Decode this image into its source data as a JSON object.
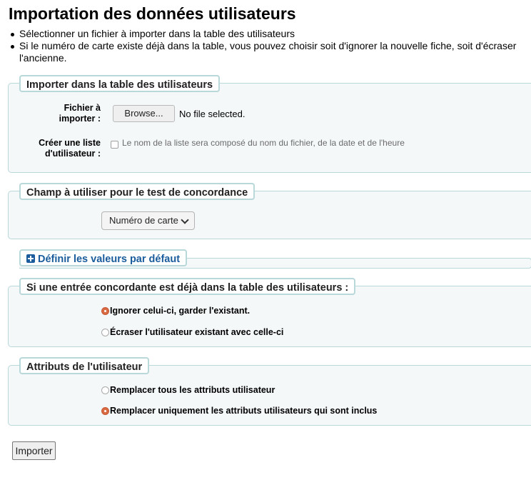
{
  "page": {
    "title": "Importation des données utilisateurs",
    "intro": [
      "Sélectionner un fichier à importer dans la table des utilisateurs",
      "Si le numéro de carte existe déjà dans la table, vous pouvez choisir soit d'ignorer la nouvelle fiche, soit d'écraser l'ancienne."
    ]
  },
  "import_section": {
    "legend": "Importer dans la table des utilisateurs",
    "file_label": [
      "Fichier à",
      "importer :"
    ],
    "browse_label": "Browse...",
    "no_file": "No file selected.",
    "list_label": [
      "Créer une liste",
      "d'utilisateur :"
    ],
    "list_hint": "Le nom de la liste sera composé du nom du fichier, de la date et de l'heure",
    "list_checked": false
  },
  "match_section": {
    "legend": "Champ à utiliser pour le test de concordance",
    "selected": "Numéro de carte"
  },
  "defaults_section": {
    "legend": "Définir les valeurs par défaut",
    "icon": "plus-square-icon"
  },
  "existing_section": {
    "legend": "Si une entrée concordante est déjà dans la table des utilisateurs :",
    "options": [
      {
        "label": "Ignorer celui-ci, garder l'existant.",
        "checked": true
      },
      {
        "label": "Écraser l'utilisateur existant avec celle-ci",
        "checked": false
      }
    ]
  },
  "attributes_section": {
    "legend": "Attributs de l'utilisateur",
    "options": [
      {
        "label": "Remplacer tous les attributs utilisateur",
        "checked": false
      },
      {
        "label": "Remplacer uniquement les attributs utilisateurs qui sont inclus",
        "checked": true
      }
    ]
  },
  "submit_label": "Importer",
  "colors": {
    "fieldset_bg": "#f4f8f9",
    "fieldset_border": "#b9d8d9",
    "link_blue": "#1a5c9c",
    "radio_checked": "#d86a44"
  }
}
